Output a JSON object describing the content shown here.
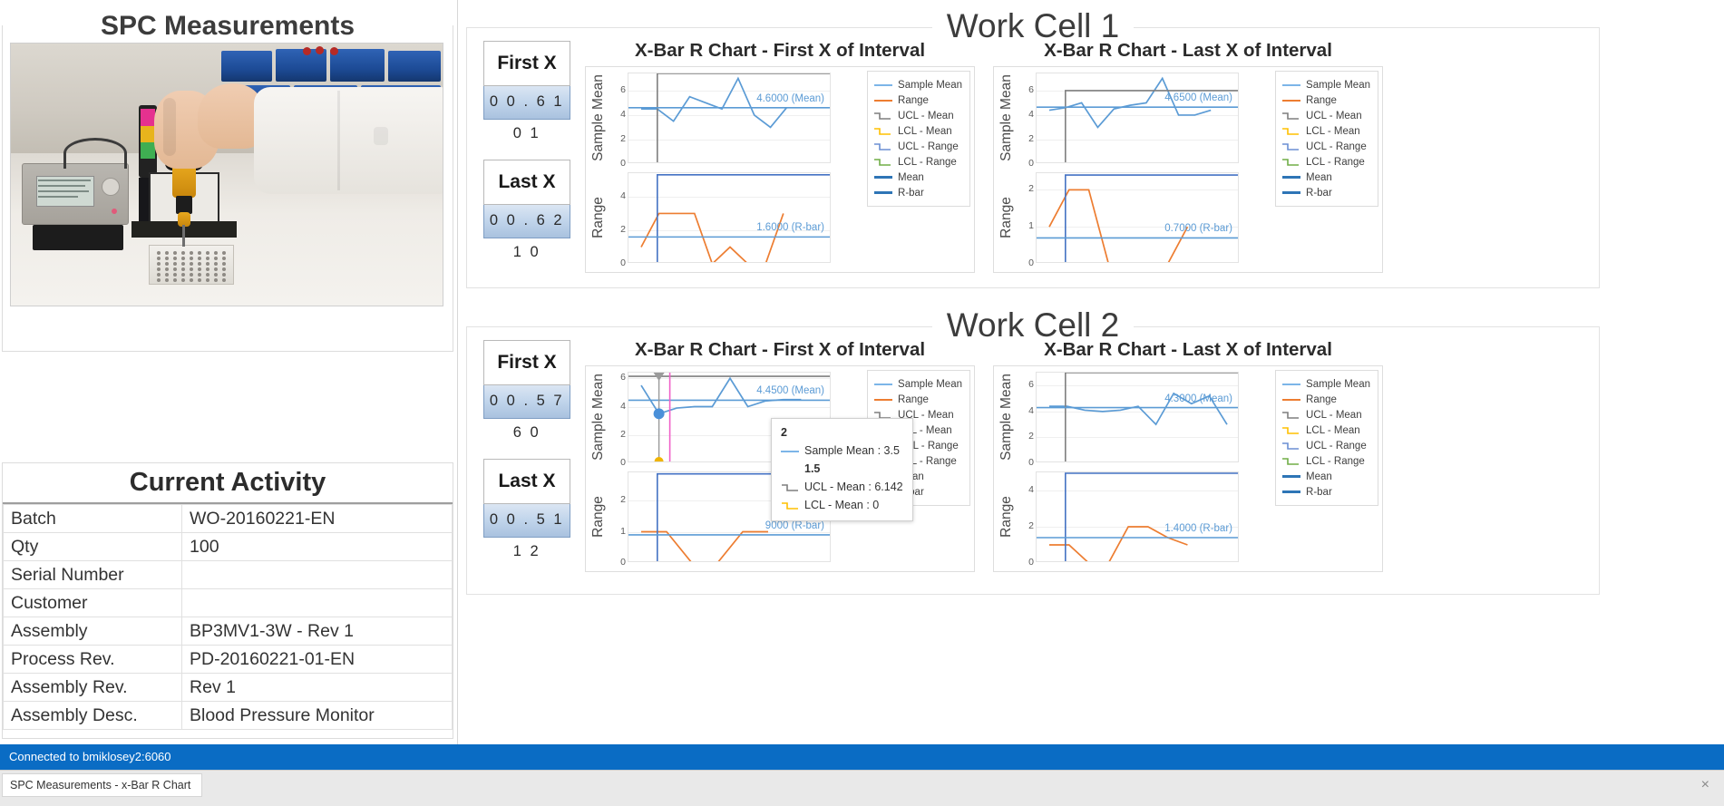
{
  "left": {
    "spc_panel_title": "SPC Measurements",
    "photo_alt": "operator-using-torque-driver-on-fixture",
    "activity": {
      "title": "Current Activity",
      "rows": [
        {
          "key": "Batch",
          "value": "WO-20160221-EN"
        },
        {
          "key": "Qty",
          "value": "100"
        },
        {
          "key": "Serial Number",
          "value": ""
        },
        {
          "key": "Customer",
          "value": ""
        },
        {
          "key": "Assembly",
          "value": "BP3MV1-3W  - Rev 1"
        },
        {
          "key": "Process Rev.",
          "value": "PD-20160221-01-EN"
        },
        {
          "key": "Assembly Rev.",
          "value": "Rev 1"
        },
        {
          "key": "Assembly Desc.",
          "value": "Blood Pressure Monitor"
        }
      ]
    }
  },
  "cells": [
    {
      "title": "Work Cell 1",
      "first_x": {
        "label": "First X",
        "value": "0 0 . 6 1 0 1"
      },
      "last_x": {
        "label": "Last X",
        "value": "0 0 . 6 2 1 0"
      },
      "charts": [
        {
          "title": "X-Bar R Chart - First X of Interval",
          "mean_annotation": "4.6000 (Mean)",
          "rbar_annotation": "1.6000 (R-bar)"
        },
        {
          "title": "X-Bar R Chart - Last X of Interval",
          "mean_annotation": "4.6500 (Mean)",
          "rbar_annotation": "0.7000 (R-bar)"
        }
      ]
    },
    {
      "title": "Work Cell 2",
      "first_x": {
        "label": "First X",
        "value": "0 0 . 5 7 6 0"
      },
      "last_x": {
        "label": "Last X",
        "value": "0 0 . 5 1 1 2"
      },
      "charts": [
        {
          "title": "X-Bar R Chart - First X of Interval",
          "mean_annotation": "4.4500 (Mean)",
          "rbar_annotation": "9000 (R-bar)"
        },
        {
          "title": "X-Bar R Chart - Last X of Interval",
          "mean_annotation": "4.3000 (Mean)",
          "rbar_annotation": "1.4000 (R-bar)"
        }
      ]
    }
  ],
  "legend": {
    "items": [
      {
        "label": "Sample Mean",
        "color": "#7cb5e8",
        "type": "line"
      },
      {
        "label": "Range",
        "color": "#ed7d31",
        "type": "line"
      },
      {
        "label": "UCL - Mean",
        "color": "#7f7f7f",
        "type": "step"
      },
      {
        "label": "LCL - Mean",
        "color": "#ffc000",
        "type": "step"
      },
      {
        "label": "UCL - Range",
        "color": "#6b8fd4",
        "type": "step"
      },
      {
        "label": "LCL - Range",
        "color": "#70ad47",
        "type": "step"
      },
      {
        "label": "Mean",
        "color": "#2e75b6",
        "type": "thick"
      },
      {
        "label": "R-bar",
        "color": "#2e75b6",
        "type": "thick"
      }
    ]
  },
  "tooltip": {
    "header": "2",
    "rows": [
      {
        "label": "Sample Mean : 3.5",
        "color": "#7cb5e8",
        "type": "line"
      },
      {
        "label": "1.5",
        "color": "",
        "type": "text"
      },
      {
        "label": "UCL - Mean : 6.142",
        "color": "#7f7f7f",
        "type": "step"
      },
      {
        "label": "LCL - Mean : 0",
        "color": "#ffc000",
        "type": "step"
      }
    ]
  },
  "statusbar": {
    "text": "Connected to bmiklosey2:6060"
  },
  "taskbar": {
    "button_label": "SPC Measurements - x-Bar R Chart",
    "close_icon": "×"
  },
  "chart_data": [
    {
      "id": "wc1-first",
      "type": "line",
      "title": "X-Bar R Chart - First X of Interval",
      "workcell": "Work Cell 1",
      "subplots": [
        {
          "ylabel": "Sample Mean",
          "yticks": [
            0,
            2,
            4,
            6
          ],
          "ylim": [
            0,
            7.4
          ],
          "grid": true,
          "series": [
            {
              "name": "Sample Mean",
              "color": "#5b9bd5",
              "x": [
                1,
                2,
                3,
                4,
                5,
                6,
                7,
                8,
                9,
                10,
                11,
                12
              ],
              "values": [
                4.5,
                4.5,
                3.5,
                5.5,
                5.0,
                4.5,
                7.0,
                4.0,
                3.0,
                4.6,
                null,
                null
              ]
            },
            {
              "name": "UCL - Mean",
              "color": "#7f7f7f",
              "constant_from": 2,
              "value": 7.4
            },
            {
              "name": "LCL - Mean",
              "color": "#ffc000",
              "value": 0
            },
            {
              "name": "Mean",
              "color": "#5b9bd5",
              "value": 4.6,
              "annotation": "4.6000 (Mean)"
            }
          ]
        },
        {
          "ylabel": "Range",
          "yticks": [
            0,
            2,
            4
          ],
          "ylim": [
            0,
            5.4
          ],
          "grid": true,
          "series": [
            {
              "name": "Range",
              "color": "#ed7d31",
              "x": [
                1,
                2,
                3,
                4,
                5,
                6,
                7,
                8,
                9,
                10,
                11
              ],
              "values": [
                1.0,
                3.0,
                3.0,
                3.0,
                0.0,
                1.0,
                0.0,
                0.0,
                3.0,
                null,
                null
              ]
            },
            {
              "name": "UCL - Range",
              "color": "#4472c4",
              "constant_from": 2,
              "value": 5.3
            },
            {
              "name": "LCL - Range",
              "color": "#70ad47",
              "value": 0
            },
            {
              "name": "R-bar",
              "color": "#5b9bd5",
              "value": 1.6,
              "annotation": "1.6000 (R-bar)"
            }
          ]
        }
      ]
    },
    {
      "id": "wc1-last",
      "type": "line",
      "title": "X-Bar R Chart - Last X of Interval",
      "workcell": "Work Cell 1",
      "subplots": [
        {
          "ylabel": "Sample Mean",
          "yticks": [
            0,
            2,
            4,
            6
          ],
          "ylim": [
            0,
            7.4
          ],
          "grid": true,
          "series": [
            {
              "name": "Sample Mean",
              "color": "#5b9bd5",
              "x": [
                1,
                2,
                3,
                4,
                5,
                6,
                7,
                8,
                9,
                10,
                11,
                12
              ],
              "values": [
                4.4,
                4.6,
                5.0,
                3.0,
                4.5,
                4.8,
                5.0,
                7.0,
                4.0,
                4.0,
                4.4,
                null
              ]
            },
            {
              "name": "UCL - Mean",
              "color": "#7f7f7f",
              "constant_from": 2,
              "value": 6.0
            },
            {
              "name": "LCL - Mean",
              "color": "#ffc000",
              "value": 0
            },
            {
              "name": "Mean",
              "color": "#5b9bd5",
              "value": 4.65,
              "annotation": "4.6500 (Mean)"
            }
          ]
        },
        {
          "ylabel": "Range",
          "yticks": [
            0,
            1,
            2
          ],
          "ylim": [
            0,
            2.45
          ],
          "grid": true,
          "series": [
            {
              "name": "Range",
              "color": "#ed7d31",
              "x": [
                1,
                2,
                3,
                4,
                5,
                6,
                7,
                8,
                9,
                10
              ],
              "values": [
                1.0,
                2.0,
                2.0,
                0.0,
                0.0,
                0.0,
                0.0,
                1.0,
                null,
                null
              ]
            },
            {
              "name": "UCL - Range",
              "color": "#4472c4",
              "constant_from": 2,
              "value": 2.4
            },
            {
              "name": "LCL - Range",
              "color": "#70ad47",
              "value": 0
            },
            {
              "name": "R-bar",
              "color": "#5b9bd5",
              "value": 0.7,
              "annotation": "0.7000 (R-bar)"
            }
          ]
        }
      ]
    },
    {
      "id": "wc2-first",
      "type": "line",
      "title": "X-Bar R Chart - First X of Interval",
      "workcell": "Work Cell 2",
      "hover_point": {
        "x": 2,
        "series": "Sample Mean",
        "value": 3.5
      },
      "subplots": [
        {
          "ylabel": "Sample Mean",
          "yticks": [
            0,
            2,
            4,
            6
          ],
          "ylim": [
            0,
            6.4
          ],
          "grid": true,
          "series": [
            {
              "name": "Sample Mean",
              "color": "#5b9bd5",
              "x": [
                1,
                2,
                3,
                4,
                5,
                6,
                7,
                8,
                9,
                10,
                11
              ],
              "values": [
                5.5,
                3.5,
                3.9,
                4.0,
                4.0,
                6.0,
                4.0,
                4.4,
                4.5,
                4.5,
                null
              ]
            },
            {
              "name": "UCL - Mean",
              "color": "#7f7f7f",
              "value": 6.142
            },
            {
              "name": "LCL - Mean",
              "color": "#ffc000",
              "value": 0
            },
            {
              "name": "Mean",
              "color": "#5b9bd5",
              "value": 4.45,
              "annotation": "4.4500 (Mean)"
            }
          ]
        },
        {
          "ylabel": "Range",
          "yticks": [
            0,
            1,
            2
          ],
          "ylim": [
            0,
            2.9
          ],
          "grid": true,
          "series": [
            {
              "name": "Range",
              "color": "#ed7d31",
              "x": [
                1,
                2,
                3,
                4,
                5,
                6,
                7,
                8
              ],
              "values": [
                1.0,
                1.0,
                0.0,
                0.0,
                1.0,
                1.0,
                null,
                null
              ]
            },
            {
              "name": "UCL - Range",
              "color": "#4472c4",
              "constant_from": 2,
              "value": 2.85
            },
            {
              "name": "LCL - Range",
              "color": "#70ad47",
              "value": 0
            },
            {
              "name": "R-bar",
              "color": "#5b9bd5",
              "value": 0.9,
              "annotation": "9000 (R-bar)"
            }
          ]
        }
      ]
    },
    {
      "id": "wc2-last",
      "type": "line",
      "title": "X-Bar R Chart - Last X of Interval",
      "workcell": "Work Cell 2",
      "subplots": [
        {
          "ylabel": "Sample Mean",
          "yticks": [
            0,
            2,
            4,
            6
          ],
          "ylim": [
            0,
            7.0
          ],
          "grid": true,
          "series": [
            {
              "name": "Sample Mean",
              "color": "#5b9bd5",
              "x": [
                1,
                2,
                3,
                4,
                5,
                6,
                7,
                8,
                9,
                10,
                11
              ],
              "values": [
                4.4,
                4.4,
                4.1,
                4.0,
                4.1,
                4.4,
                3.0,
                5.4,
                4.6,
                5.2,
                3.0
              ]
            },
            {
              "name": "UCL - Mean",
              "color": "#7f7f7f",
              "constant_from": 2,
              "value": 7.0
            },
            {
              "name": "LCL - Mean",
              "color": "#ffc000",
              "value": 0
            },
            {
              "name": "Mean",
              "color": "#5b9bd5",
              "value": 4.3,
              "annotation": "4.3000 (Mean)"
            }
          ]
        },
        {
          "ylabel": "Range",
          "yticks": [
            0,
            2,
            4
          ],
          "ylim": [
            0,
            5.0
          ],
          "grid": true,
          "series": [
            {
              "name": "Range",
              "color": "#ed7d31",
              "x": [
                1,
                2,
                3,
                4,
                5,
                6,
                7,
                8,
                9,
                10
              ],
              "values": [
                1.0,
                1.0,
                0.0,
                0.0,
                2.0,
                2.0,
                1.4,
                1.0,
                null,
                null
              ]
            },
            {
              "name": "UCL - Range",
              "color": "#4472c4",
              "constant_from": 2,
              "value": 4.95
            },
            {
              "name": "LCL - Range",
              "color": "#70ad47",
              "value": 0
            },
            {
              "name": "R-bar",
              "color": "#5b9bd5",
              "value": 1.4,
              "annotation": "1.4000 (R-bar)"
            }
          ]
        }
      ]
    }
  ]
}
